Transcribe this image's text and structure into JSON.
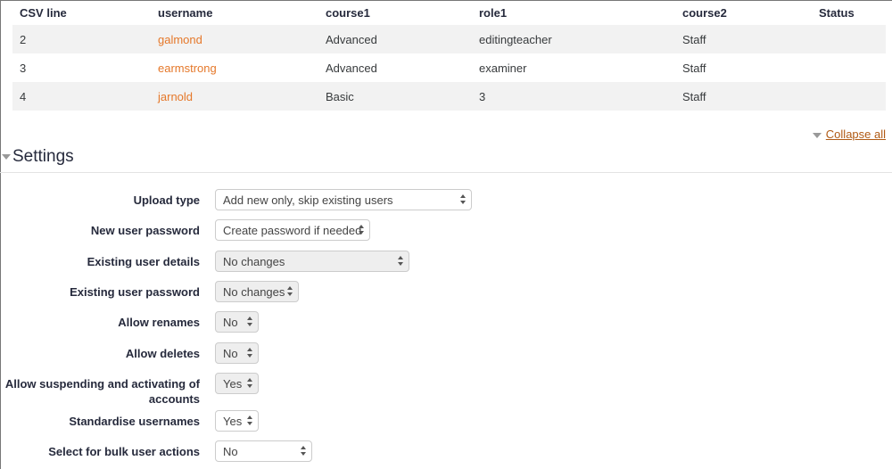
{
  "table": {
    "headers": [
      "CSV line",
      "username",
      "course1",
      "role1",
      "course2",
      "Status"
    ],
    "rows": [
      {
        "csv_line": "2",
        "username": "galmond",
        "course1": "Advanced",
        "role1": "editingteacher",
        "course2": "Staff",
        "status": ""
      },
      {
        "csv_line": "3",
        "username": "earmstrong",
        "course1": "Advanced",
        "role1": "examiner",
        "course2": "Staff",
        "status": ""
      },
      {
        "csv_line": "4",
        "username": "jarnold",
        "course1": "Basic",
        "role1": "3",
        "course2": "Staff",
        "status": ""
      }
    ]
  },
  "collapse_all_label": "Collapse all",
  "settings": {
    "title": "Settings",
    "fields": [
      {
        "label": "Upload type",
        "value": "Add new only, skip existing users"
      },
      {
        "label": "New user password",
        "value": "Create password if needed"
      },
      {
        "label": "Existing user details",
        "value": "No changes"
      },
      {
        "label": "Existing user password",
        "value": "No changes"
      },
      {
        "label": "Allow renames",
        "value": "No"
      },
      {
        "label": "Allow deletes",
        "value": "No"
      },
      {
        "label": "Allow suspending and activating of accounts",
        "value": "Yes"
      },
      {
        "label": "Standardise usernames",
        "value": "Yes"
      },
      {
        "label": "Select for bulk user actions",
        "value": "No"
      }
    ]
  },
  "colors": {
    "link": "#e5782a",
    "collapse_link": "#b05a14",
    "label": "#262a3c"
  }
}
